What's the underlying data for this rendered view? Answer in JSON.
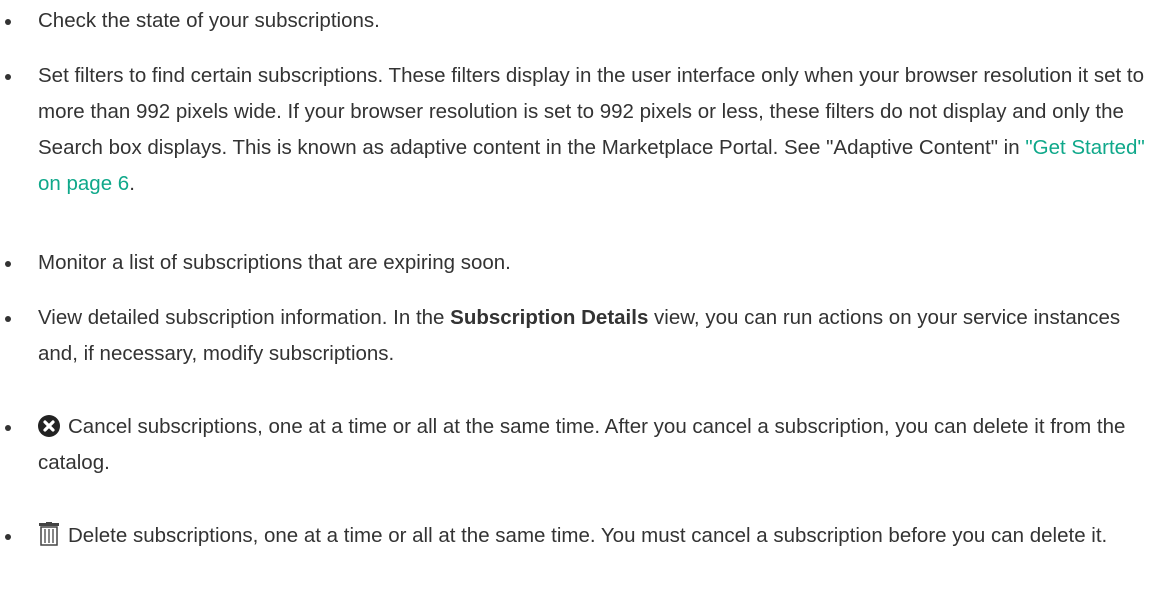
{
  "items": [
    {
      "text": "Check the state of your subscriptions."
    },
    {
      "text_before_link": "Set filters to find certain subscriptions. These filters display in the user interface only when your browser resolution it set to more than 992 pixels wide. If your browser resolution is set to 992 pixels or less, these filters do not display and only the Search box displays. This is known as adaptive content in the Marketplace Portal. See \"Adaptive Content\" in ",
      "link_text": "\"Get Started\" on page 6",
      "text_after_link": "."
    },
    {
      "text": "Monitor a list of subscriptions that are expiring soon."
    },
    {
      "text_before_bold": "View detailed subscription information. In the ",
      "bold_text": "Subscription Details",
      "text_after_bold": " view, you can run actions on your service instances and, if necessary, modify subscriptions."
    },
    {
      "icon": "cancel-icon",
      "text": "Cancel subscriptions, one at a time or all at the same time. After you cancel a subscription, you can delete it from the catalog."
    },
    {
      "icon": "trash-icon",
      "text": "Delete subscriptions, one at a time or all at the same time. You must cancel a subscription before you can delete it."
    }
  ],
  "colors": {
    "text": "#333333",
    "link": "#0fa88a"
  }
}
